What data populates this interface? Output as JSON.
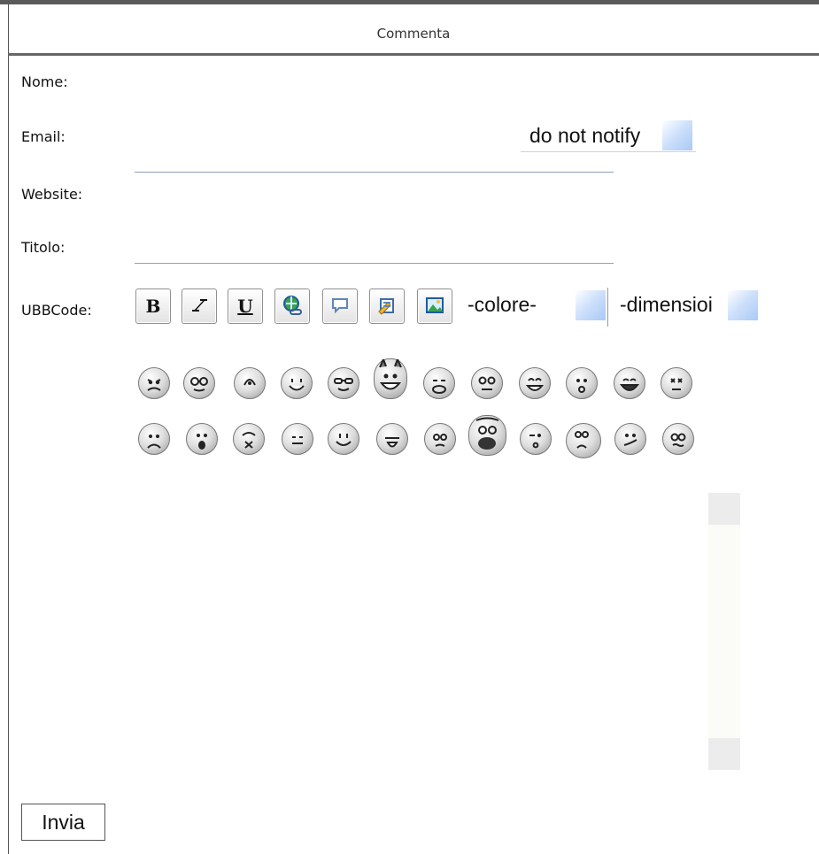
{
  "form": {
    "title": "Commenta",
    "labels": {
      "name": "Nome:",
      "email": "Email:",
      "website": "Website:",
      "subject": "Titolo:",
      "ubbcode": "UBBCode:"
    },
    "notify_option": "do not notify",
    "submit_label": "Invia"
  },
  "toolbar": {
    "bold": "B",
    "underline": "U",
    "color_select": "-colore-",
    "size_select": "-dimensioni-",
    "size_select_visible": "-dimensioi"
  },
  "smileys": {
    "row1": [
      "angry",
      "cool-glasses",
      "dizzy",
      "grin",
      "nerd",
      "devil",
      "drooling",
      "wide-eyed",
      "happy",
      "surprised",
      "laughing",
      "disgusted"
    ],
    "row2": [
      "crying",
      "shocked",
      "scared",
      "blank",
      "smile",
      "tongue",
      "confused",
      "big-laugh",
      "wink",
      "sick",
      "smirk",
      "hypnotized"
    ]
  }
}
